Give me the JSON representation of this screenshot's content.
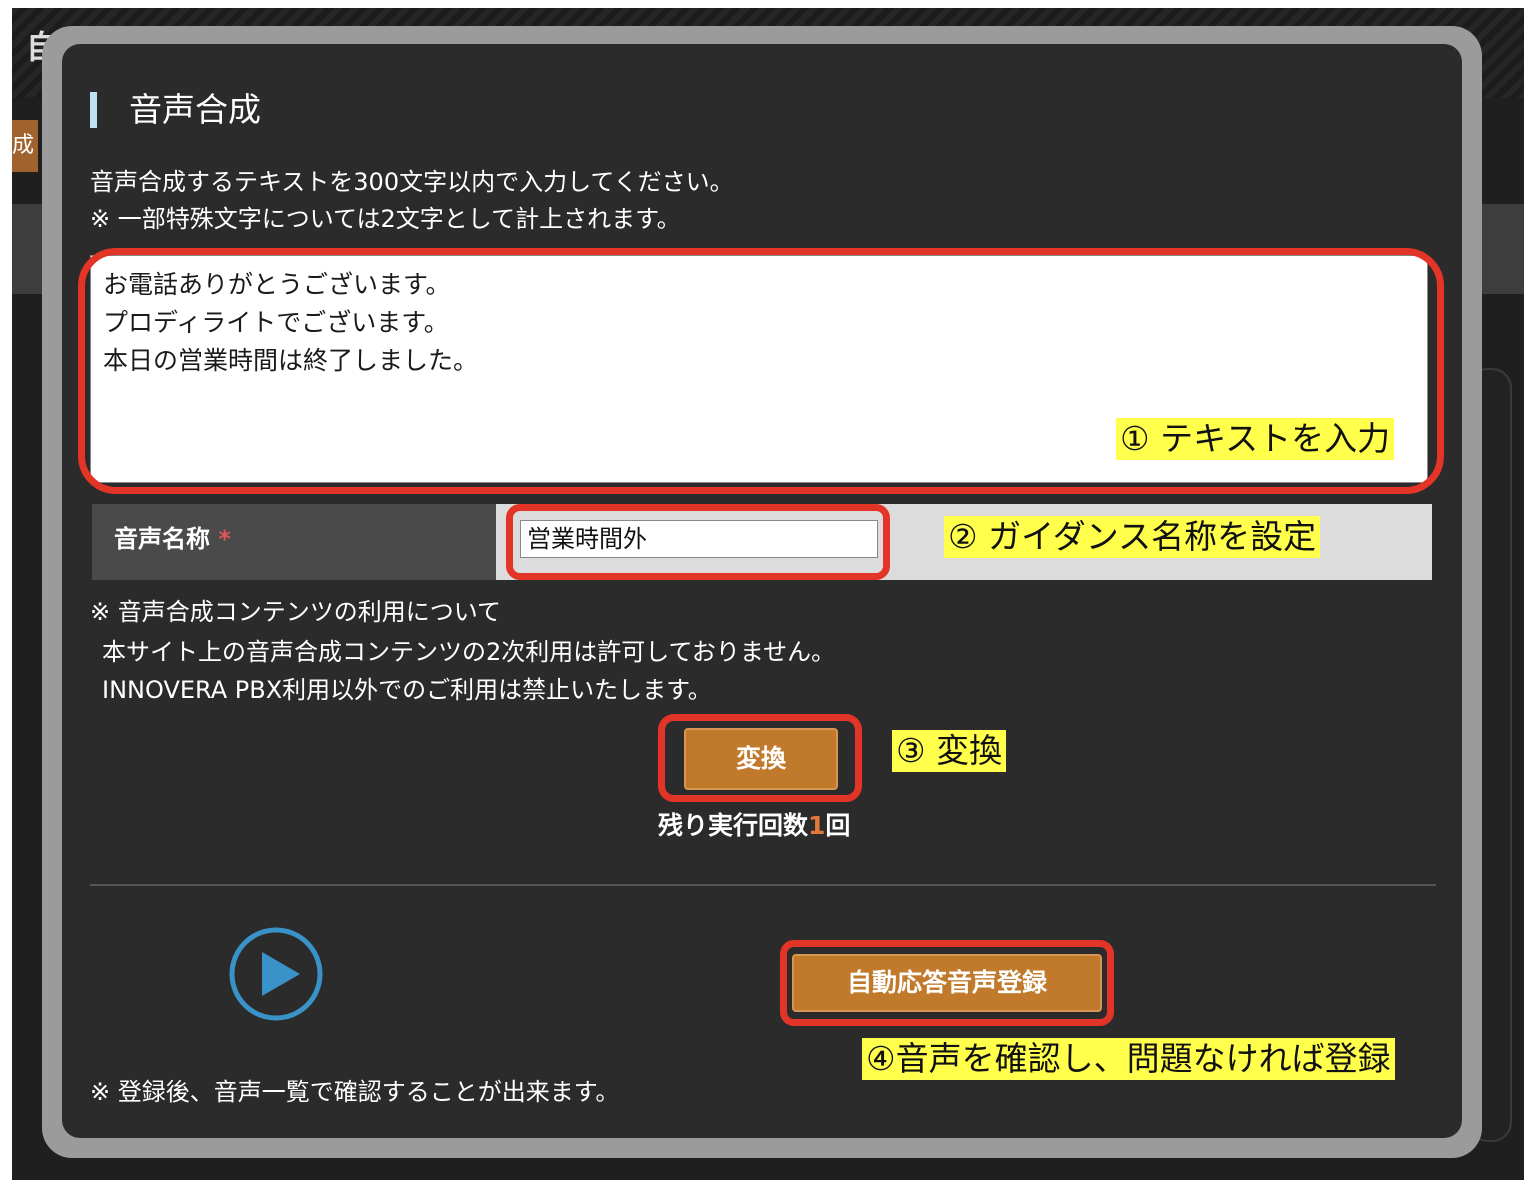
{
  "background": {
    "title": "自",
    "tab_label": "成"
  },
  "dialog": {
    "title": "音声合成",
    "instruction_1": "音声合成するテキストを300文字以内で入力してください。",
    "instruction_2": "※ 一部特殊文字については2文字として計上されます。",
    "text_lines": [
      "お電話ありがとうございます。",
      "プロディライトでございます。",
      "本日の営業時間は終了しました。"
    ],
    "name_label": "音声名称",
    "required_mark": "*",
    "name_value": "営業時間外",
    "notice_1": "※ 音声合成コンテンツの利用について",
    "notice_2": "本サイト上の音声合成コンテンツの2次利用は許可しておりません。",
    "notice_3": "INNOVERA PBX利用以外でのご利用は禁止いたします。",
    "convert_button": "変換",
    "remaining_prefix": "残り実行回数",
    "remaining_count": "1",
    "remaining_suffix": "回",
    "register_button": "自動応答音声登録",
    "footer_note": "※ 登録後、音声一覧で確認することが出来ます。"
  },
  "annotations": {
    "step1": "① テキストを入力",
    "step2": "② ガイダンス名称を設定",
    "step3": "③ 変換",
    "step4": "④音声を確認し、問題なければ登録"
  },
  "colors": {
    "highlight_border": "#e23427",
    "annotation_bg": "#ffff4c",
    "button_orange": "#c17a2c",
    "play_icon": "#3a93c8"
  },
  "icons": {
    "play": "play-icon"
  }
}
